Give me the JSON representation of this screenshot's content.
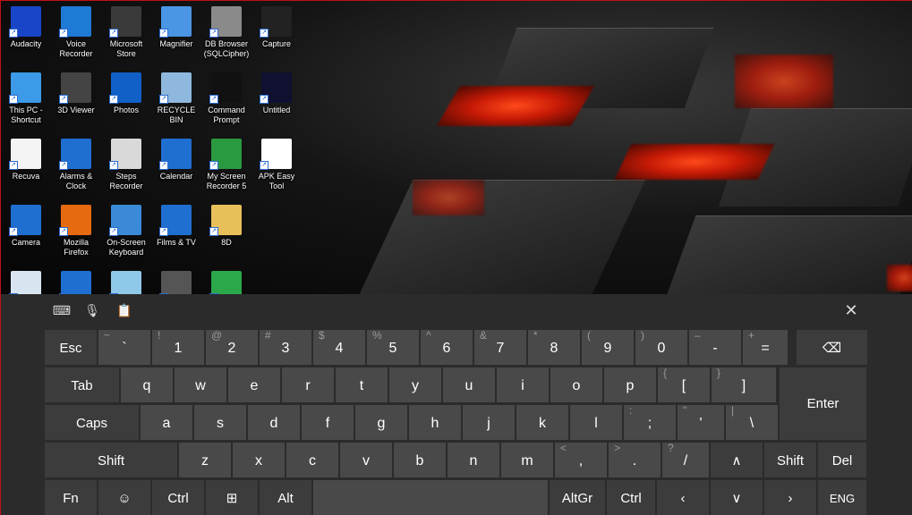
{
  "desktop": {
    "icons": [
      {
        "label": "Audacity",
        "icon": "audacity-icon",
        "color": "#1946c8"
      },
      {
        "label": "Voice Recorder",
        "icon": "microphone-icon",
        "color": "#1f7ad6"
      },
      {
        "label": "Microsoft Store",
        "icon": "store-bag-icon",
        "color": "#3a3a3a"
      },
      {
        "label": "Magnifier",
        "icon": "magnifier-icon",
        "color": "#4a96e4"
      },
      {
        "label": "DB Browser (SQLCipher)",
        "icon": "database-icon",
        "color": "#8a8a8a"
      },
      {
        "label": "Capture",
        "icon": "capture-icon",
        "color": "#222222"
      },
      {
        "label": "This PC - Shortcut",
        "icon": "computer-icon",
        "color": "#3c9ae8"
      },
      {
        "label": "3D Viewer",
        "icon": "cube-icon",
        "color": "#444444"
      },
      {
        "label": "Photos",
        "icon": "photos-icon",
        "color": "#1060c8"
      },
      {
        "label": "RECYCLE BIN",
        "icon": "recycle-bin-icon",
        "color": "#8fb8de"
      },
      {
        "label": "Command Prompt",
        "icon": "command-prompt-icon",
        "color": "#111111"
      },
      {
        "label": "Untitled",
        "icon": "tech-logo-icon",
        "color": "#101030"
      },
      {
        "label": "Recuva",
        "icon": "document-icon",
        "color": "#f4f4f4"
      },
      {
        "label": "Alarms & Clock",
        "icon": "clock-icon",
        "color": "#1e6fd0"
      },
      {
        "label": "Steps Recorder",
        "icon": "steps-recorder-icon",
        "color": "#d9d9d9"
      },
      {
        "label": "Calendar",
        "icon": "calendar-icon",
        "color": "#1f6fd0"
      },
      {
        "label": "My Screen Recorder 5",
        "icon": "screen-recorder-icon",
        "color": "#2a9a40"
      },
      {
        "label": "APK Easy Tool",
        "icon": "apk-tool-icon",
        "color": "#ffffff"
      },
      {
        "label": "Camera",
        "icon": "camera-icon",
        "color": "#1f6fd0"
      },
      {
        "label": "Mozilla Firefox",
        "icon": "firefox-icon",
        "color": "#e66a10"
      },
      {
        "label": "On-Screen Keyboard",
        "icon": "keyboard-icon",
        "color": "#3a8ad8"
      },
      {
        "label": "Films & TV",
        "icon": "films-tv-icon",
        "color": "#1f6fd0"
      },
      {
        "label": "8D",
        "icon": "folder-icon",
        "color": "#e8c05a"
      },
      {
        "label": "",
        "icon": "lambda-icon",
        "color": "#d8e4f0"
      },
      {
        "label": "",
        "icon": "disc-icon",
        "color": "#1f6fd0"
      },
      {
        "label": "",
        "icon": "pencil-icon",
        "color": "#8fc8e8"
      },
      {
        "label": "",
        "icon": "film-strip-icon",
        "color": "#555555"
      },
      {
        "label": "",
        "icon": "green-app-icon",
        "color": "#2aa84a"
      }
    ]
  },
  "keyboard": {
    "toolbar": {
      "keyboard_settings_icon": "⌨",
      "mic_icon": "🎙",
      "clipboard_icon": "📋",
      "close_icon": "✕"
    },
    "row1": [
      {
        "pri": "Esc",
        "sec": ""
      },
      {
        "pri": "`",
        "sec": "~"
      },
      {
        "pri": "1",
        "sec": "!"
      },
      {
        "pri": "2",
        "sec": "@"
      },
      {
        "pri": "3",
        "sec": "#"
      },
      {
        "pri": "4",
        "sec": "$"
      },
      {
        "pri": "5",
        "sec": "%"
      },
      {
        "pri": "6",
        "sec": "^"
      },
      {
        "pri": "7",
        "sec": "&"
      },
      {
        "pri": "8",
        "sec": "*"
      },
      {
        "pri": "9",
        "sec": "("
      },
      {
        "pri": "0",
        "sec": ")"
      },
      {
        "pri": "-",
        "sec": "–"
      },
      {
        "pri": "=",
        "sec": "+"
      },
      {
        "pri": "⌫",
        "sec": ""
      }
    ],
    "row2": [
      {
        "pri": "Tab",
        "sec": ""
      },
      {
        "pri": "q",
        "sec": ""
      },
      {
        "pri": "w",
        "sec": ""
      },
      {
        "pri": "e",
        "sec": ""
      },
      {
        "pri": "r",
        "sec": ""
      },
      {
        "pri": "t",
        "sec": ""
      },
      {
        "pri": "y",
        "sec": ""
      },
      {
        "pri": "u",
        "sec": ""
      },
      {
        "pri": "i",
        "sec": ""
      },
      {
        "pri": "o",
        "sec": ""
      },
      {
        "pri": "p",
        "sec": ""
      },
      {
        "pri": "[",
        "sec": "{"
      },
      {
        "pri": "]",
        "sec": "}"
      },
      {
        "pri": "Enter",
        "sec": ""
      }
    ],
    "row3": [
      {
        "pri": "Caps",
        "sec": ""
      },
      {
        "pri": "a",
        "sec": ""
      },
      {
        "pri": "s",
        "sec": ""
      },
      {
        "pri": "d",
        "sec": ""
      },
      {
        "pri": "f",
        "sec": ""
      },
      {
        "pri": "g",
        "sec": ""
      },
      {
        "pri": "h",
        "sec": ""
      },
      {
        "pri": "j",
        "sec": ""
      },
      {
        "pri": "k",
        "sec": ""
      },
      {
        "pri": "l",
        "sec": ""
      },
      {
        "pri": ";",
        "sec": ":"
      },
      {
        "pri": "'",
        "sec": "\""
      },
      {
        "pri": "\\",
        "sec": "|"
      }
    ],
    "row4": [
      {
        "pri": "Shift",
        "sec": ""
      },
      {
        "pri": "z",
        "sec": ""
      },
      {
        "pri": "x",
        "sec": ""
      },
      {
        "pri": "c",
        "sec": ""
      },
      {
        "pri": "v",
        "sec": ""
      },
      {
        "pri": "b",
        "sec": ""
      },
      {
        "pri": "n",
        "sec": ""
      },
      {
        "pri": "m",
        "sec": ""
      },
      {
        "pri": ",",
        "sec": "<"
      },
      {
        "pri": ".",
        "sec": ">"
      },
      {
        "pri": "/",
        "sec": "?"
      },
      {
        "pri": "∧",
        "sec": ""
      },
      {
        "pri": "Shift",
        "sec": ""
      },
      {
        "pri": "Del",
        "sec": ""
      }
    ],
    "row5": [
      {
        "pri": "Fn",
        "sec": ""
      },
      {
        "pri": "☺",
        "sec": ""
      },
      {
        "pri": "Ctrl",
        "sec": ""
      },
      {
        "pri": "⊞",
        "sec": ""
      },
      {
        "pri": "Alt",
        "sec": ""
      },
      {
        "pri": "",
        "sec": ""
      },
      {
        "pri": "AltGr",
        "sec": ""
      },
      {
        "pri": "Ctrl",
        "sec": ""
      },
      {
        "pri": "‹",
        "sec": ""
      },
      {
        "pri": "∨",
        "sec": ""
      },
      {
        "pri": "›",
        "sec": ""
      },
      {
        "pri": "ENG",
        "sec": ""
      }
    ]
  }
}
